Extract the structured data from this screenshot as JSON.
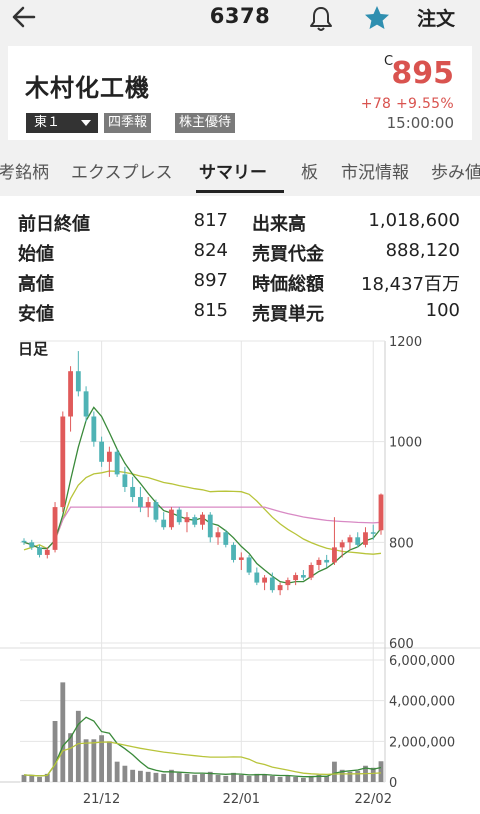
{
  "header": {
    "code": "6378",
    "order_label": "注文"
  },
  "stock": {
    "name": "木村化工機",
    "market": "東１",
    "tags": [
      "四季報",
      "株主優待"
    ],
    "price_flag": "C",
    "price": "895",
    "change": "+78  +9.55%",
    "time": "15:00:00"
  },
  "tabs": [
    {
      "label": "考銘柄"
    },
    {
      "label": "エクスプレス"
    },
    {
      "label": "サマリー",
      "active": true
    },
    {
      "label": "板"
    },
    {
      "label": "市況情報"
    },
    {
      "label": "歩み値"
    }
  ],
  "summary": {
    "rows": [
      {
        "l1": "前日終値",
        "v1": "817",
        "l2": "出来高",
        "v2": "1,018,600"
      },
      {
        "l1": "始値",
        "v1": "824",
        "l2": "売買代金",
        "v2": "888,120"
      },
      {
        "l1": "高値",
        "v1": "897",
        "l2": "時価総額",
        "v2": "18,437百万"
      },
      {
        "l1": "安値",
        "v1": "815",
        "l2": "売買単元",
        "v2": "100"
      }
    ]
  },
  "colors": {
    "up": "#e05a5a",
    "down": "#4fb3b5",
    "ma_short": "#3a8a3a",
    "ma_mid": "#b8c43a",
    "ma_long": "#d889c4",
    "volume": "#8a8a8a"
  },
  "chart_data": {
    "type": "candlestick",
    "title": "日足",
    "price_axis": {
      "ticks": [
        "1200",
        "1000",
        "800",
        "600"
      ],
      "range": [
        600,
        1200
      ]
    },
    "volume_axis": {
      "ticks": [
        "6,000,000",
        "4,000,000",
        "2,000,000",
        "0"
      ],
      "range": [
        0,
        6000000
      ]
    },
    "x_ticks": [
      {
        "label": "21/12",
        "index": 10
      },
      {
        "label": "22/01",
        "index": 28
      },
      {
        "label": "22/02",
        "index": 45
      }
    ],
    "candles": [
      [
        803,
        808,
        795,
        800
      ],
      [
        800,
        805,
        785,
        790
      ],
      [
        790,
        795,
        770,
        775
      ],
      [
        775,
        790,
        768,
        785
      ],
      [
        785,
        880,
        780,
        870
      ],
      [
        870,
        1060,
        860,
        1050
      ],
      [
        1050,
        1150,
        1020,
        1140
      ],
      [
        1140,
        1180,
        1090,
        1100
      ],
      [
        1100,
        1110,
        1040,
        1050
      ],
      [
        1050,
        1060,
        990,
        1000
      ],
      [
        1000,
        1010,
        950,
        960
      ],
      [
        960,
        990,
        930,
        980
      ],
      [
        980,
        985,
        930,
        935
      ],
      [
        935,
        950,
        900,
        910
      ],
      [
        910,
        930,
        880,
        890
      ],
      [
        890,
        910,
        860,
        870
      ],
      [
        870,
        890,
        850,
        880
      ],
      [
        880,
        885,
        840,
        845
      ],
      [
        845,
        860,
        825,
        830
      ],
      [
        830,
        870,
        825,
        865
      ],
      [
        865,
        870,
        835,
        840
      ],
      [
        840,
        860,
        820,
        850
      ],
      [
        850,
        855,
        830,
        835
      ],
      [
        835,
        860,
        825,
        855
      ],
      [
        855,
        860,
        800,
        810
      ],
      [
        810,
        830,
        795,
        820
      ],
      [
        820,
        825,
        790,
        795
      ],
      [
        795,
        800,
        760,
        765
      ],
      [
        765,
        780,
        745,
        770
      ],
      [
        770,
        775,
        735,
        740
      ],
      [
        740,
        750,
        715,
        720
      ],
      [
        720,
        735,
        705,
        730
      ],
      [
        730,
        740,
        700,
        705
      ],
      [
        705,
        720,
        695,
        715
      ],
      [
        715,
        730,
        705,
        725
      ],
      [
        725,
        740,
        715,
        735
      ],
      [
        735,
        745,
        725,
        730
      ],
      [
        730,
        760,
        725,
        755
      ],
      [
        755,
        770,
        745,
        765
      ],
      [
        765,
        775,
        750,
        760
      ],
      [
        760,
        850,
        755,
        790
      ],
      [
        790,
        805,
        770,
        800
      ],
      [
        800,
        815,
        785,
        810
      ],
      [
        810,
        820,
        790,
        795
      ],
      [
        795,
        830,
        790,
        820
      ],
      [
        820,
        835,
        805,
        817
      ],
      [
        824,
        897,
        815,
        895
      ]
    ],
    "volumes": [
      0.35,
      0.3,
      0.25,
      0.4,
      3.0,
      4.9,
      2.4,
      3.5,
      2.1,
      2.1,
      2.3,
      2.0,
      1.0,
      0.8,
      0.6,
      0.55,
      0.5,
      0.45,
      0.4,
      0.6,
      0.45,
      0.4,
      0.35,
      0.4,
      0.5,
      0.35,
      0.3,
      0.45,
      0.35,
      0.3,
      0.4,
      0.35,
      0.3,
      0.25,
      0.3,
      0.25,
      0.2,
      0.3,
      0.35,
      0.3,
      1.0,
      0.6,
      0.5,
      0.55,
      0.8,
      0.7,
      1.02
    ]
  }
}
